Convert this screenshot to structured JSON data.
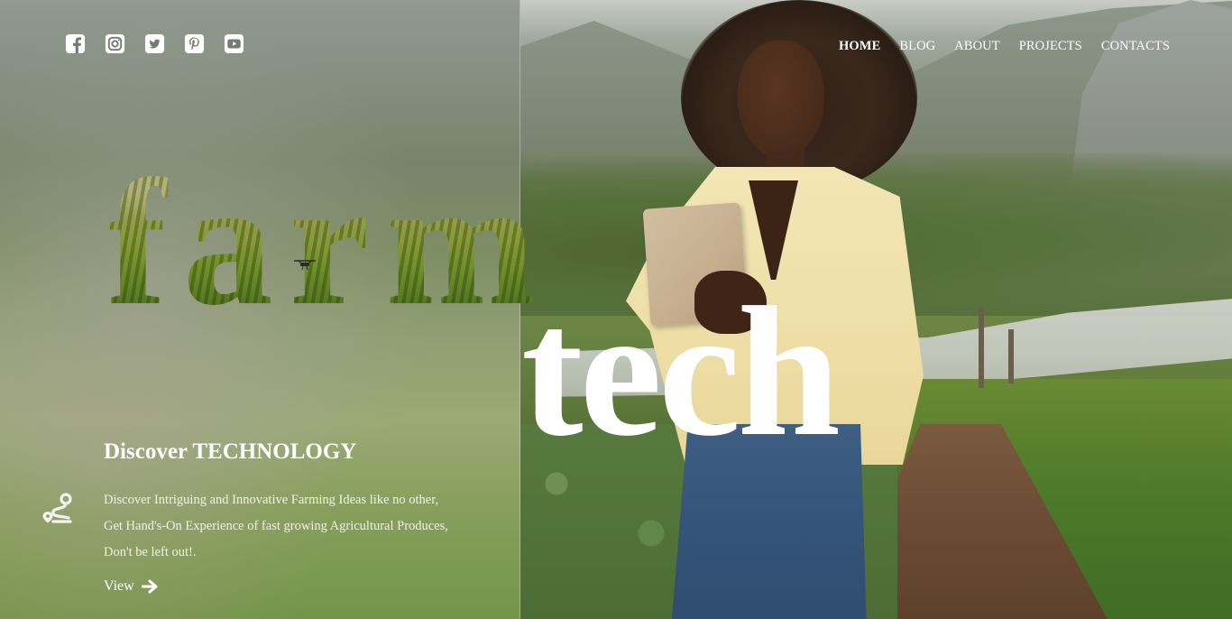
{
  "social": {
    "items": [
      {
        "icon": "facebook-icon"
      },
      {
        "icon": "instagram-icon"
      },
      {
        "icon": "twitter-icon"
      },
      {
        "icon": "pinterest-icon"
      },
      {
        "icon": "youtube-icon"
      }
    ]
  },
  "nav": {
    "items": [
      {
        "label": "HOME",
        "active": true
      },
      {
        "label": "BLOG",
        "active": false
      },
      {
        "label": "ABOUT",
        "active": false
      },
      {
        "label": "PROJECTS",
        "active": false
      },
      {
        "label": "CONTACTS",
        "active": false
      }
    ]
  },
  "hero": {
    "word_1": "farm",
    "word_2": "tech"
  },
  "content": {
    "heading": "Discover TECHNOLOGY",
    "description_lines": [
      "Discover Intriguing and Innovative Farming Ideas like no other,",
      "Get Hand's-On Experience of fast growing Agricultural Produces,",
      "Don't be left out!."
    ],
    "view_label": "View",
    "route_icon": "route-icon",
    "arrow_icon": "arrow-right-icon"
  },
  "colors": {
    "text": "#ffffff",
    "shirt": "#f3e6b5",
    "jeans": "#36567c"
  }
}
